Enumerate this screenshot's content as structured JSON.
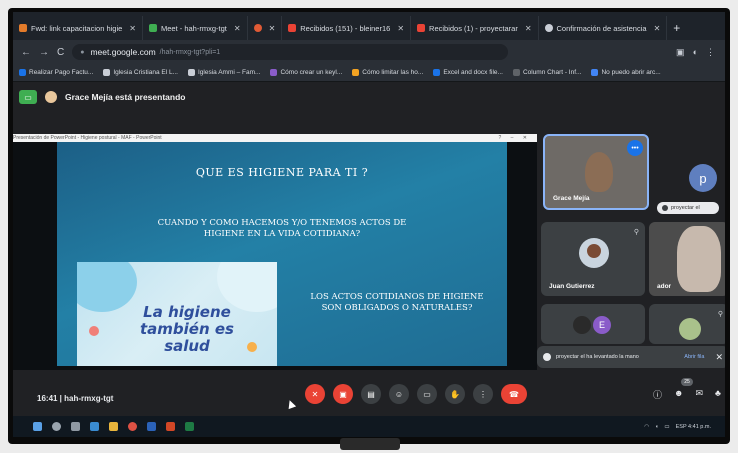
{
  "browser": {
    "tabs": [
      {
        "label": "Fwd: link capacitacion higie",
        "color": "#e37b2a"
      },
      {
        "label": "Meet - hah-rmxg-tgt",
        "color": "#3fae52"
      },
      {
        "label": "",
        "color": "#e05a35"
      },
      {
        "label": "Recibidos (151) - bleiner16",
        "color": "#ea4335"
      },
      {
        "label": "Recibidos (1) - proyectarar",
        "color": "#ea4335"
      },
      {
        "label": "Confirmación de asistencia",
        "color": "#c9ced6"
      }
    ],
    "url": "meet.google.com",
    "url_rest": "/hah-rmxg-tgt?pli=1",
    "bookmarks": [
      {
        "label": "Realizar Pago Factu...",
        "color": "#1a73e8"
      },
      {
        "label": "Iglesia Cristiana El L...",
        "color": "#c9ced6"
      },
      {
        "label": "Iglesia Ammi – Fam...",
        "color": "#c9ced6"
      },
      {
        "label": "Cómo crear un keyl...",
        "color": "#8a5cc9"
      },
      {
        "label": "Cómo limitar las ho...",
        "color": "#f4a322"
      },
      {
        "label": "Excel and docx file...",
        "color": "#1a73e8"
      },
      {
        "label": "Column Chart - Inf...",
        "color": "#5f6368"
      },
      {
        "label": "No puedo abrir arc...",
        "color": "#4285f4"
      }
    ]
  },
  "meet": {
    "presenting_text": "Grace Mejía está presentando",
    "ppt_title": "Presentación de PowerPoint - Higiene postural - MAF - PowerPoint",
    "slide": {
      "title": "QUE ES HIGIENE PARA TI ?",
      "question": "CUANDO Y COMO HACEMOS Y/O TENEMOS ACTOS DE HIGIENE EN LA VIDA COTIDIANA?",
      "statement": "LOS ACTOS COTIDIANOS DE HIGIENE SON OBLIGADOS O NATURALES?",
      "image_caption": "La higiene también es salud"
    },
    "participants": {
      "presenter_name": "Grace Mejía",
      "avatar_letter": "p",
      "pill_label": "proyectar el",
      "second_name": "Juan Gutierrez",
      "third_name": "ador",
      "fourth_letter": "E"
    },
    "toast": {
      "message": "proyectar el ha levantado la mano",
      "open_label": "Abrir fila"
    },
    "bottom": {
      "time_code": "16:41 | hah-rmxg-tgt",
      "notif_count": "25"
    }
  },
  "taskbar": {
    "tray_text": "ESP 4:41 p.m."
  }
}
